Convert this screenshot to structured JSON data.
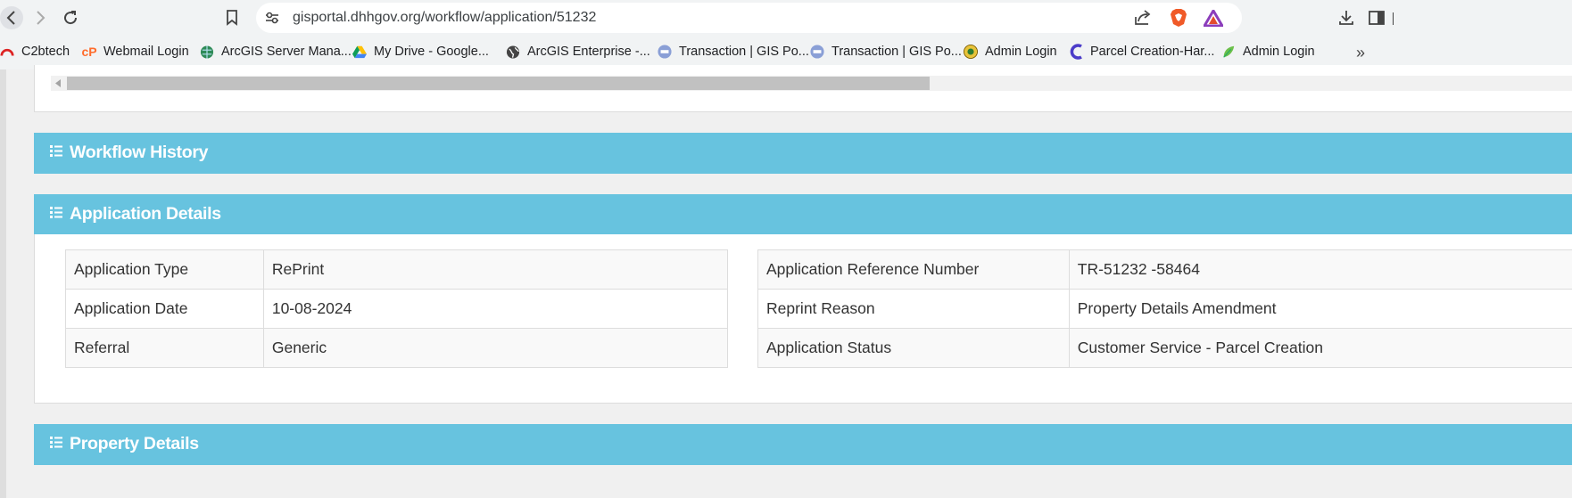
{
  "browser": {
    "url": "gisportal.dhhgov.org/workflow/application/51232",
    "bookmarks": [
      {
        "label": "C2btech",
        "icon": "c2btech-icon"
      },
      {
        "label": "Webmail Login",
        "icon": "cpanel-icon"
      },
      {
        "label": "ArcGIS Server Mana...",
        "icon": "arcgis-globe-icon"
      },
      {
        "label": "My Drive - Google...",
        "icon": "google-drive-icon"
      },
      {
        "label": "ArcGIS Enterprise -...",
        "icon": "globe-icon"
      },
      {
        "label": "Transaction | GIS Po...",
        "icon": "portal-icon"
      },
      {
        "label": "Transaction | GIS Po...",
        "icon": "portal-icon"
      },
      {
        "label": "Admin Login",
        "icon": "emblem-icon"
      },
      {
        "label": "Parcel Creation-Har...",
        "icon": "c-logo-icon"
      },
      {
        "label": "Admin Login",
        "icon": "admin-leaf-icon"
      }
    ]
  },
  "page": {
    "workflow_history_title": "Workflow History",
    "application_details_title": "Application Details",
    "property_details_title": "Property Details",
    "details_left": [
      {
        "label": "Application Type",
        "value": "RePrint"
      },
      {
        "label": "Application Date",
        "value": "10-08-2024"
      },
      {
        "label": "Referral",
        "value": "Generic"
      }
    ],
    "details_right": [
      {
        "label": "Application Reference Number",
        "value": "TR-51232 -58464"
      },
      {
        "label": "Reprint Reason",
        "value": "Property Details Amendment"
      },
      {
        "label": "Application Status",
        "value": "Customer Service - Parcel Creation"
      }
    ]
  }
}
